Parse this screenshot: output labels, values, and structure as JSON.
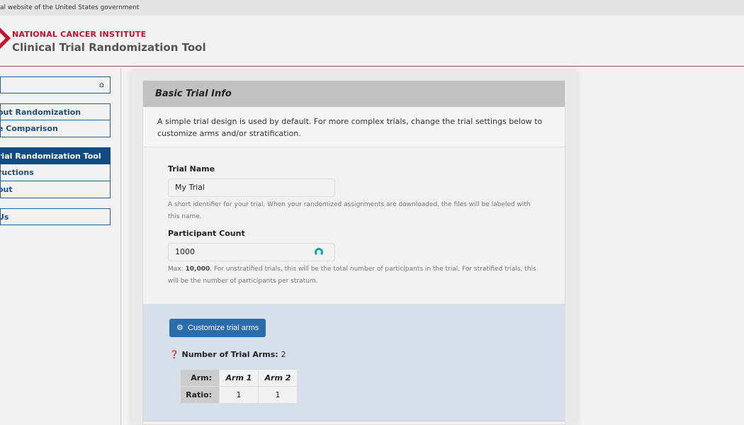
{
  "gov_banner": "al website of the United States government",
  "header": {
    "org": "NATIONAL CANCER INSTITUTE",
    "title": "Clinical Trial Randomization Tool"
  },
  "sidebar": {
    "groups": [
      [
        "out Randomization",
        "e Comparison"
      ],
      [
        "rial Randomization Tool",
        "ructions",
        "out"
      ],
      [
        "Us"
      ]
    ],
    "active": "rial Randomization Tool"
  },
  "panel": {
    "title": "Basic Trial Info",
    "description": "A simple trial design is used by default. For more complex trials, change the trial settings below to customize arms and/or stratification."
  },
  "trial_name": {
    "label": "Trial Name",
    "value": "My Trial",
    "help": "A short identifier for your trial. When your randomized assignments are downloaded, the files will be labeled with this name."
  },
  "participant_count": {
    "label": "Participant Count",
    "value": "1000",
    "help_prefix": "Max: ",
    "help_max": "10,000",
    "help_rest": ". For unstratified trials, this will be the total number of participants in the trial. For stratified trials, this will be the number of participants per stratum."
  },
  "arms": {
    "button": "Customize trial arms",
    "count_label": "Number of Trial Arms:",
    "count": "2",
    "row_arm": "Arm:",
    "row_ratio": "Ratio:",
    "names": [
      "Arm 1",
      "Arm 2"
    ],
    "ratios": [
      "1",
      "1"
    ]
  }
}
